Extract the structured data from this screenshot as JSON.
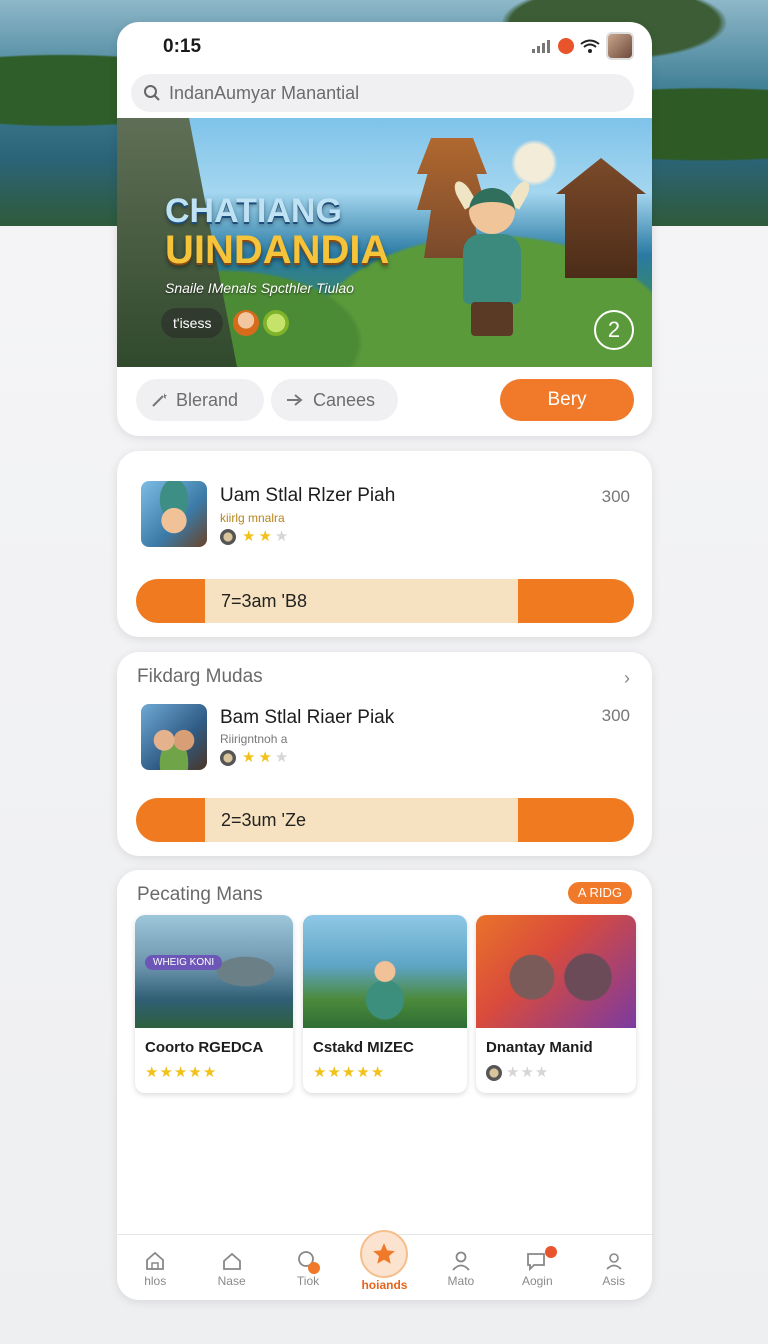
{
  "status": {
    "time": "0:15"
  },
  "search": {
    "placeholder": "IndanAumyar Manantial"
  },
  "hero": {
    "title_line1": "CHATIANG",
    "title_line2": "UINDANDIA",
    "subtitle": "Snaile IMenals Spcthler Tiulao",
    "chip": "t'isess",
    "badge": "2"
  },
  "actions": {
    "blend": "Blerand",
    "canes": "Canees",
    "buy": "Bery"
  },
  "item1": {
    "name": "Uam Stlal Rlzer Piah",
    "tag": "kiirlg mnalra",
    "price": "300",
    "rating": 2,
    "rating_max": 3,
    "bar_text": "7=3am 'B8"
  },
  "item2": {
    "section_title": "Fikdarg Mudas",
    "name": "Bam Stlal Riaer Piak",
    "tag": "Riirigntnoh a",
    "price": "300",
    "rating": 2,
    "rating_max": 3,
    "bar_text": "2=3um 'Ze"
  },
  "games": {
    "section_title": "Pecating Mans",
    "badge": "A RIDG",
    "items": [
      {
        "name": "Coorto RGEDCA",
        "art_label": "WHEIG KONI",
        "rating": 5,
        "rating_max": 5
      },
      {
        "name": "Cstakd MIZEC",
        "rating": 5,
        "rating_max": 5
      },
      {
        "name": "Dnantay Manid",
        "rating": 0,
        "rating_max": 3
      }
    ]
  },
  "nav": {
    "items": [
      {
        "label": "hlos",
        "icon": "home-icon"
      },
      {
        "label": "Nase",
        "icon": "house-icon"
      },
      {
        "label": "Tiok",
        "icon": "search-icon"
      },
      {
        "label": "hoiands",
        "icon": "star-icon",
        "active": true
      },
      {
        "label": "Mato",
        "icon": "user-icon"
      },
      {
        "label": "Aogin",
        "icon": "chat-icon"
      },
      {
        "label": "Asis",
        "icon": "profile-icon"
      }
    ]
  },
  "colors": {
    "accent": "#f07a2a",
    "bar_bg": "#f6e2c0",
    "star": "#f2c21a"
  }
}
